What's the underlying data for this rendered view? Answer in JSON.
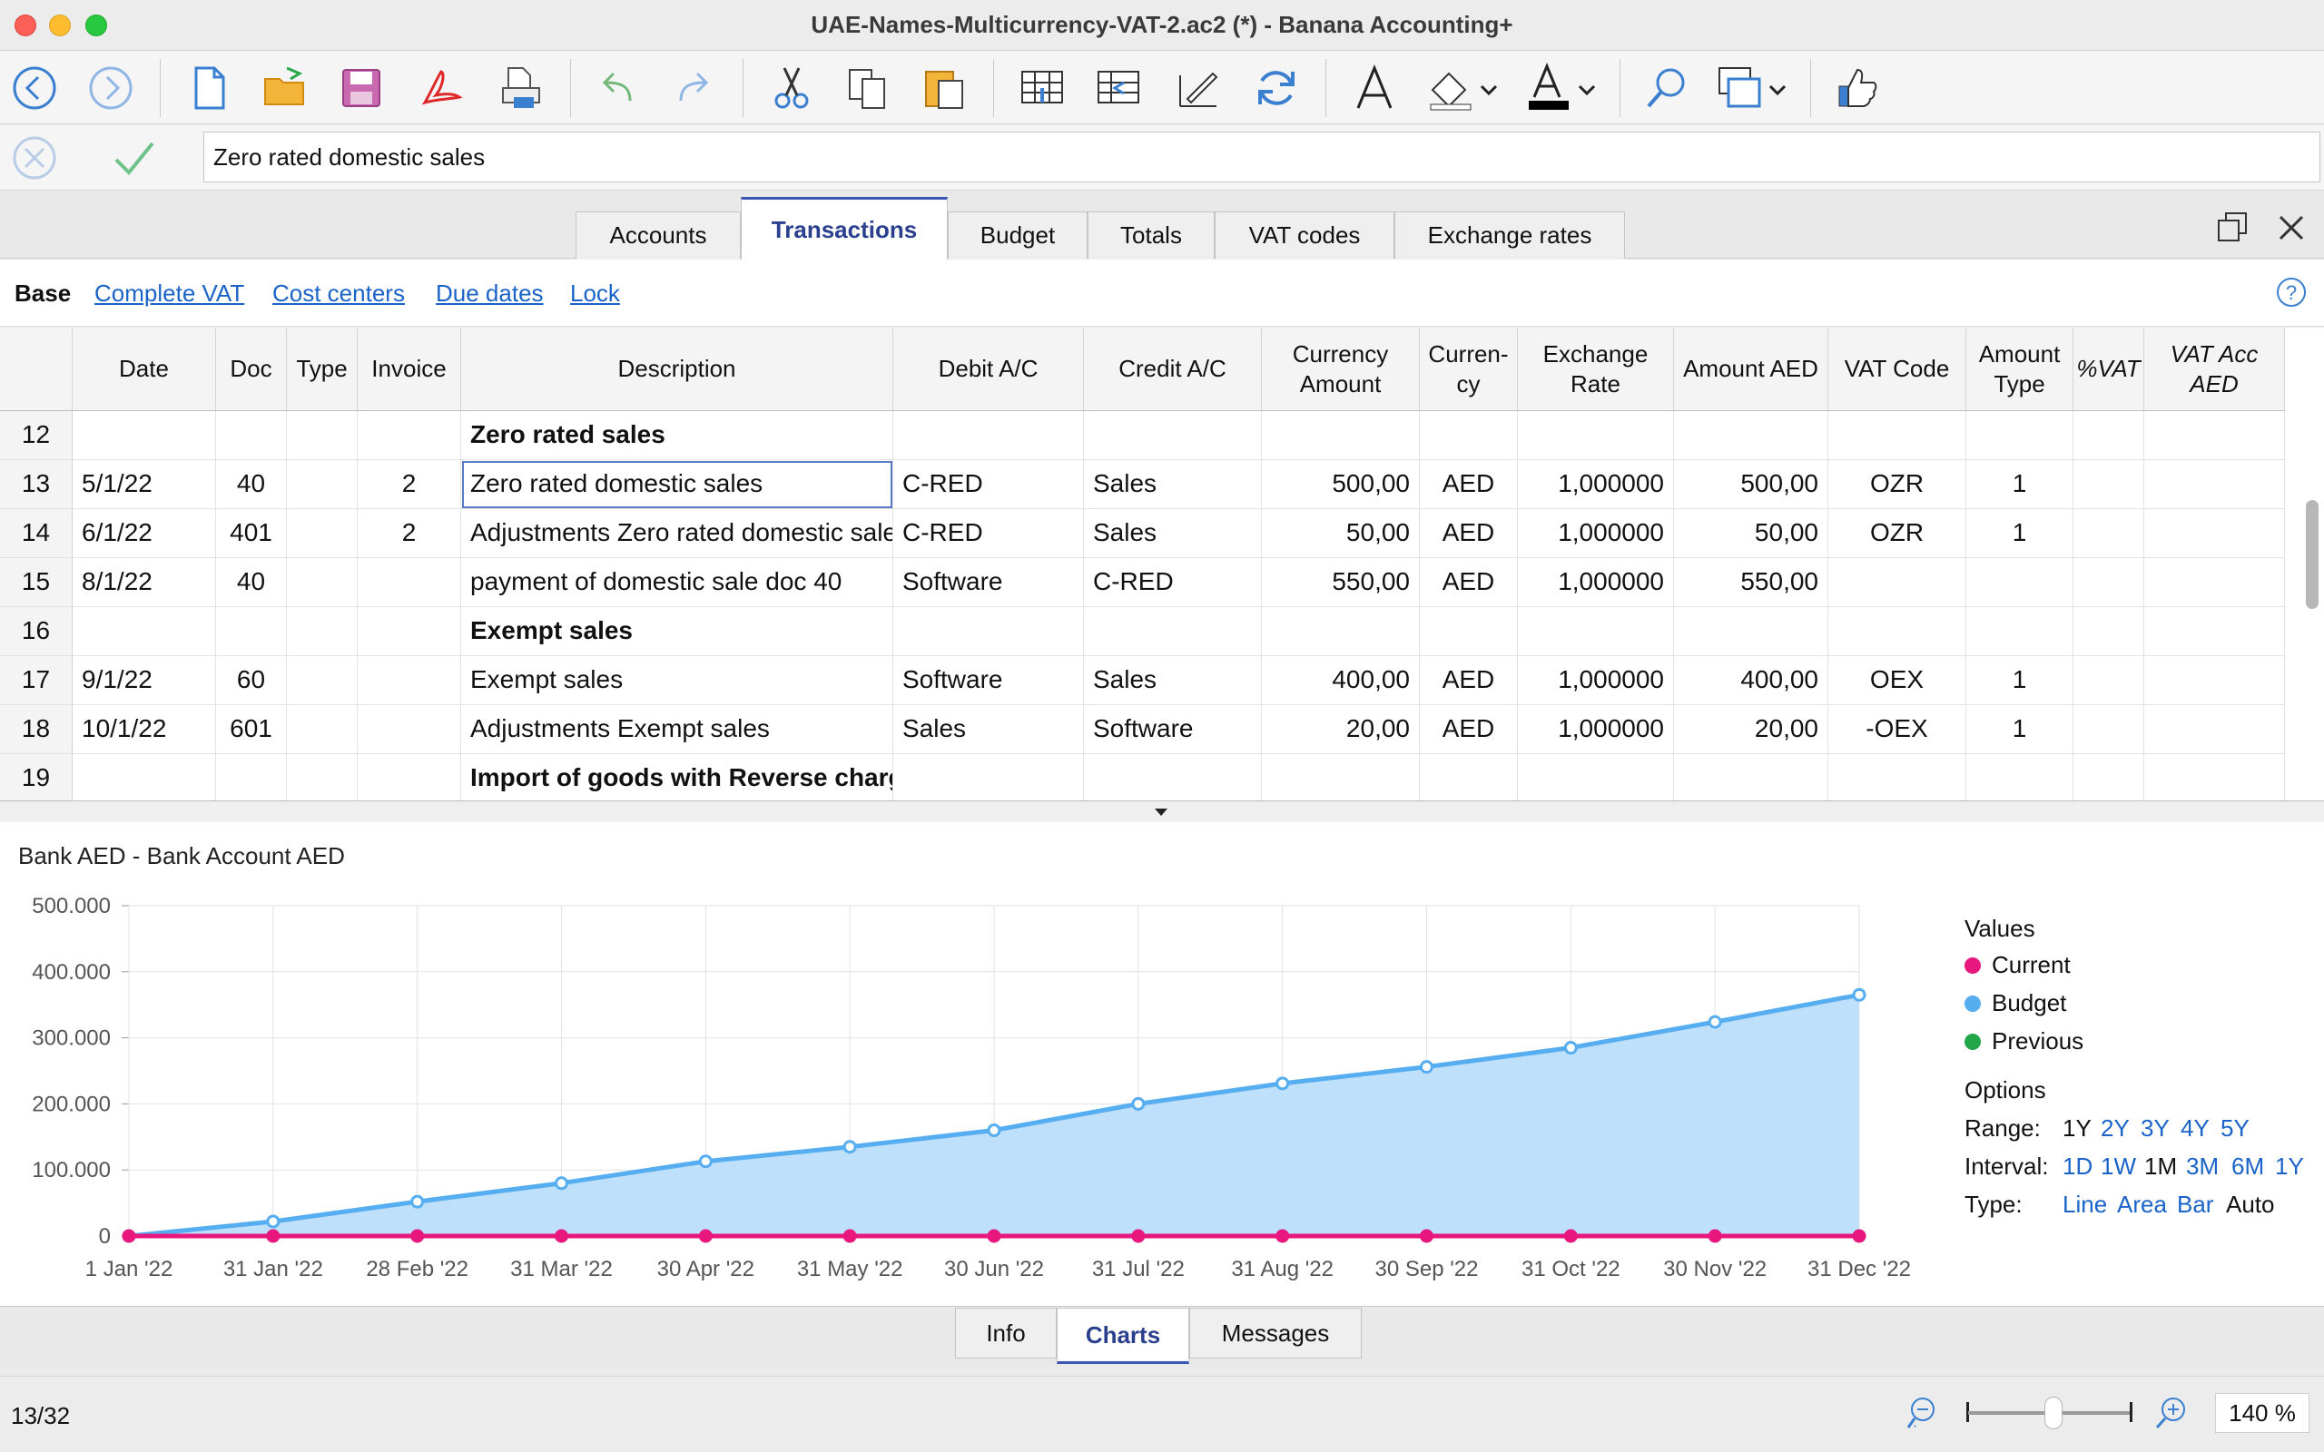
{
  "window": {
    "title": "UAE-Names-Multicurrency-VAT-2.ac2 (*) - Banana Accounting+"
  },
  "editline": {
    "value": "Zero rated domestic sales"
  },
  "tabs": [
    "Accounts",
    "Transactions",
    "Budget",
    "Totals",
    "VAT codes",
    "Exchange rates"
  ],
  "active_tab": "Transactions",
  "views": [
    "Base",
    "Complete VAT",
    "Cost centers",
    "Due dates",
    "Lock"
  ],
  "table": {
    "columns": [
      "Date",
      "Doc",
      "Type",
      "Invoice",
      "Description",
      "Debit A/C",
      "Credit A/C",
      "Currency Amount",
      "Curren-cy",
      "Exchange Rate",
      "Amount AED",
      "VAT Code",
      "Amount Type",
      "%VAT",
      "VAT Acc AED"
    ],
    "rows": [
      {
        "n": "12",
        "date": "",
        "doc": "",
        "type": "",
        "invoice": "",
        "desc": "Zero rated sales",
        "bold": true,
        "debit": "",
        "credit": "",
        "camount": "",
        "cur": "",
        "rate": "",
        "amount": "",
        "vat": "",
        "atype": ""
      },
      {
        "n": "13",
        "date": "5/1/22",
        "doc": "40",
        "type": "",
        "invoice": "2",
        "desc": "Zero rated domestic sales",
        "bold": false,
        "debit": "C-RED",
        "credit": "Sales",
        "camount": "500,00",
        "cur": "AED",
        "rate": "1,000000",
        "amount": "500,00",
        "vat": "OZR",
        "atype": "1"
      },
      {
        "n": "14",
        "date": "6/1/22",
        "doc": "401",
        "type": "",
        "invoice": "2",
        "desc": "Adjustments Zero rated domestic sales",
        "bold": false,
        "debit": "C-RED",
        "credit": "Sales",
        "camount": "50,00",
        "cur": "AED",
        "rate": "1,000000",
        "amount": "50,00",
        "vat": "OZR",
        "atype": "1"
      },
      {
        "n": "15",
        "date": "8/1/22",
        "doc": "40",
        "type": "",
        "invoice": "",
        "desc": "payment of domestic sale doc 40",
        "bold": false,
        "debit": "Software",
        "credit": "C-RED",
        "camount": "550,00",
        "cur": "AED",
        "rate": "1,000000",
        "amount": "550,00",
        "vat": "",
        "atype": ""
      },
      {
        "n": "16",
        "date": "",
        "doc": "",
        "type": "",
        "invoice": "",
        "desc": "Exempt sales",
        "bold": true,
        "debit": "",
        "credit": "",
        "camount": "",
        "cur": "",
        "rate": "",
        "amount": "",
        "vat": "",
        "atype": ""
      },
      {
        "n": "17",
        "date": "9/1/22",
        "doc": "60",
        "type": "",
        "invoice": "",
        "desc": "Exempt sales",
        "bold": false,
        "debit": "Software",
        "credit": "Sales",
        "camount": "400,00",
        "cur": "AED",
        "rate": "1,000000",
        "amount": "400,00",
        "vat": "OEX",
        "atype": "1"
      },
      {
        "n": "18",
        "date": "10/1/22",
        "doc": "601",
        "type": "",
        "invoice": "",
        "desc": "Adjustments Exempt sales",
        "bold": false,
        "debit": "Sales",
        "credit": "Software",
        "camount": "20,00",
        "cur": "AED",
        "rate": "1,000000",
        "amount": "20,00",
        "vat": "-OEX",
        "atype": "1"
      },
      {
        "n": "19",
        "date": "",
        "doc": "",
        "type": "",
        "invoice": "",
        "desc": "Import of goods with Reverse charge",
        "bold": true,
        "debit": "",
        "credit": "",
        "camount": "",
        "cur": "",
        "rate": "",
        "amount": "",
        "vat": "",
        "atype": ""
      }
    ]
  },
  "chart": {
    "title": "Bank AED - Bank Account AED",
    "legend_title": "Values",
    "legend": [
      {
        "name": "Current",
        "color": "#e8177d"
      },
      {
        "name": "Budget",
        "color": "#56aef0"
      },
      {
        "name": "Previous",
        "color": "#22a64a"
      }
    ],
    "options_title": "Options",
    "range_label": "Range:",
    "range_values": [
      "1Y",
      "2Y",
      "3Y",
      "4Y",
      "5Y"
    ],
    "range_current": "1Y",
    "interval_label": "Interval:",
    "interval_values": [
      "1D",
      "1W",
      "1M",
      "3M",
      "6M",
      "1Y"
    ],
    "interval_current": "1M",
    "type_label": "Type:",
    "type_values": [
      "Line",
      "Area",
      "Bar",
      "Auto"
    ],
    "type_current": "Auto"
  },
  "chart_data": {
    "type": "area",
    "title": "Bank AED - Bank Account AED",
    "xlabel": "",
    "ylabel": "",
    "ylim": [
      0,
      500000
    ],
    "y_ticks": [
      "0",
      "100.000",
      "200.000",
      "300.000",
      "400.000",
      "500.000"
    ],
    "categories": [
      "1 Jan '22",
      "31 Jan '22",
      "28 Feb '22",
      "31 Mar '22",
      "30 Apr '22",
      "31 May '22",
      "30 Jun '22",
      "31 Jul '22",
      "31 Aug '22",
      "30 Sep '22",
      "31 Oct '22",
      "30 Nov '22",
      "31 Dec '22"
    ],
    "series": [
      {
        "name": "Budget",
        "color": "#56aef0",
        "values": [
          0,
          22000,
          52000,
          80000,
          113000,
          135000,
          160000,
          200000,
          231000,
          256000,
          285000,
          324000,
          365000
        ]
      },
      {
        "name": "Current",
        "color": "#e8177d",
        "values": [
          0,
          0,
          0,
          0,
          0,
          0,
          0,
          0,
          0,
          0,
          0,
          0,
          0
        ]
      }
    ],
    "grid": true,
    "legend_position": "right"
  },
  "bottom_tabs": [
    "Info",
    "Charts",
    "Messages"
  ],
  "active_bottom_tab": "Charts",
  "status": {
    "position": "13/32",
    "zoom": "140 %"
  }
}
